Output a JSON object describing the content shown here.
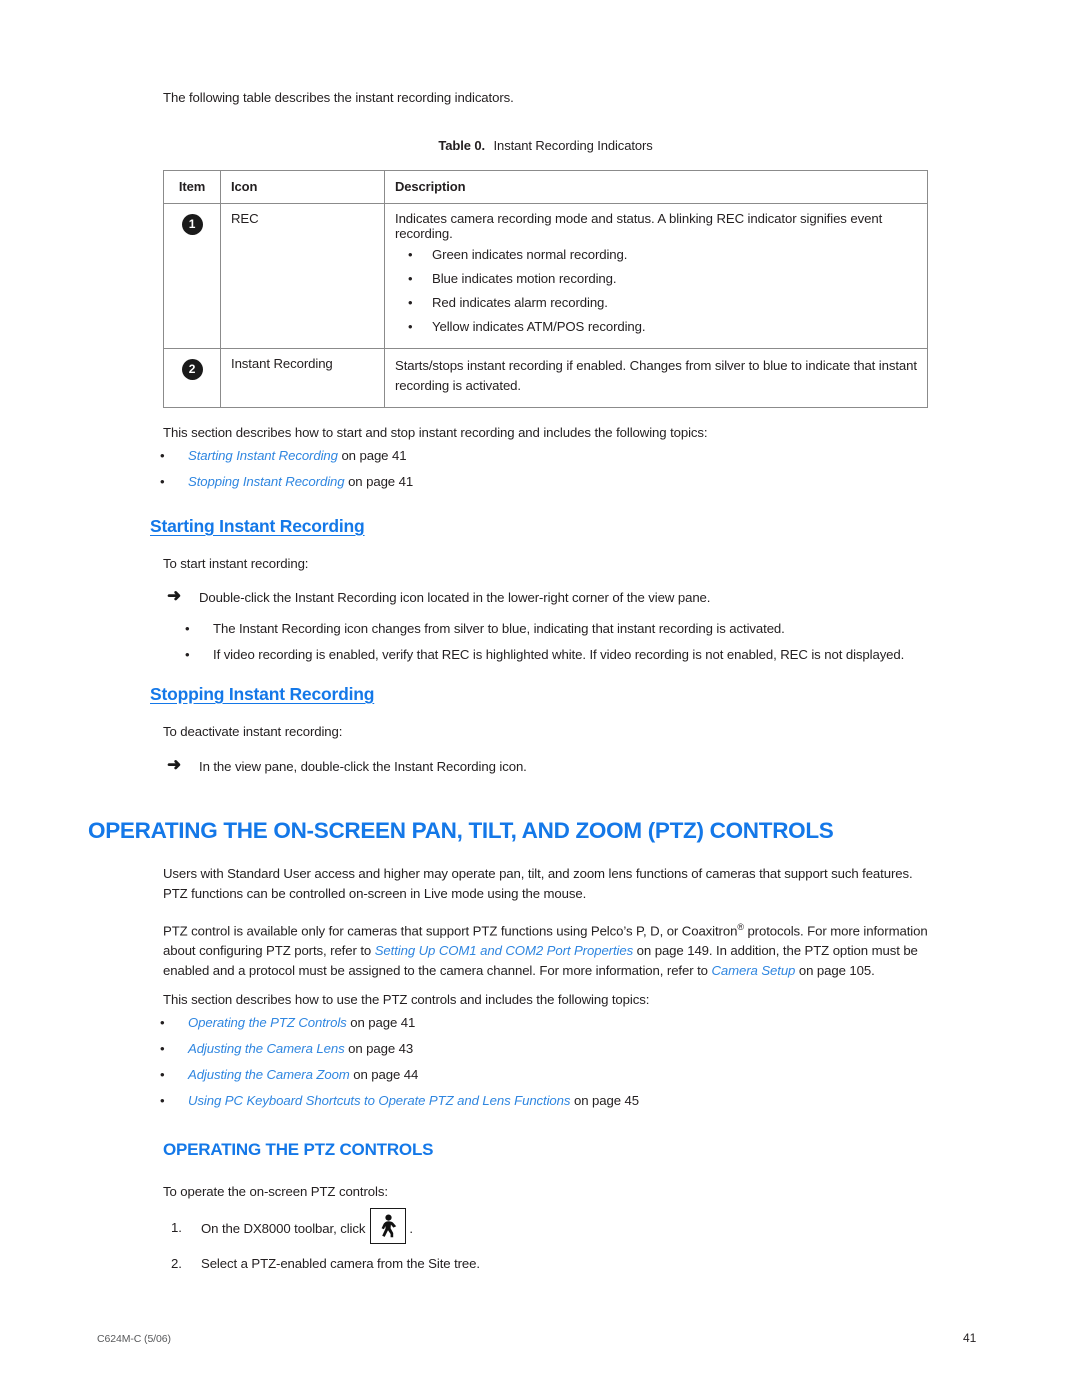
{
  "intro": {
    "lead": "The following table describes the instant recording indicators."
  },
  "table": {
    "caption_label": "Table 0.",
    "caption_text": "Instant Recording Indicators",
    "headers": {
      "item": "Item",
      "icon": "Icon",
      "description": "Description"
    },
    "rows": [
      {
        "item": "1",
        "icon": "REC",
        "description_lead": "Indicates camera recording mode and status. A blinking REC indicator signifies event recording.",
        "description_bullets": [
          "Green indicates normal recording.",
          "Blue indicates motion recording.",
          "Red indicates alarm recording.",
          "Yellow indicates ATM/POS recording."
        ]
      },
      {
        "item": "2",
        "icon": "Instant Recording",
        "description_lead": "Starts/stops instant recording if enabled. Changes from silver to blue to indicate that instant recording is activated.",
        "description_bullets": []
      }
    ]
  },
  "instant_recording": {
    "section_lead": "This section describes how to start and stop instant recording and includes the following topics:",
    "topics": [
      {
        "link": "Starting Instant Recording",
        "suffix": " on page 41"
      },
      {
        "link": "Stopping Instant Recording",
        "suffix": " on page 41"
      }
    ],
    "starting": {
      "heading": "Starting Instant Recording",
      "lead": "To start instant recording:",
      "arrow_step": "Double-click the Instant Recording icon located in the lower-right corner of the view pane.",
      "notes": [
        "The Instant Recording icon changes from silver to blue, indicating that instant recording is activated.",
        "If video recording is enabled, verify that REC is highlighted white. If video recording is not enabled, REC is not displayed."
      ]
    },
    "stopping": {
      "heading": "Stopping Instant Recording",
      "lead": "To deactivate instant recording:",
      "arrow_step": "In the view pane, double-click the Instant Recording icon."
    }
  },
  "ptz": {
    "heading": "OPERATING THE ON-SCREEN PAN, TILT, AND ZOOM (PTZ) CONTROLS",
    "para1": "Users with Standard User access and higher may operate pan, tilt, and zoom lens functions of cameras that support such features. PTZ functions can be controlled on-screen in Live mode using the mouse.",
    "para2_part1": "PTZ control is available only for cameras that support PTZ functions using Pelco’s P, D, or Coaxitron",
    "para2_reg": "®",
    "para2_part2": " protocols. For more information about configuring PTZ ports, refer to ",
    "para2_link1": "Setting Up COM1 and COM2 Port Properties",
    "para2_part3": " on page 149. In addition, the PTZ option must be enabled and a protocol must be assigned to the camera channel. For more information, refer to ",
    "para2_link2": "Camera Setup",
    "para2_part4": " on page 105.",
    "topics_lead": "This section describes how to use the PTZ controls and includes the following topics:",
    "topics": [
      {
        "link": "Operating the PTZ Controls",
        "suffix": " on page 41"
      },
      {
        "link": "Adjusting the Camera Lens",
        "suffix": " on page 43"
      },
      {
        "link": "Adjusting the Camera Zoom",
        "suffix": " on page 44"
      },
      {
        "link": "Using PC Keyboard Shortcuts to Operate PTZ and Lens Functions",
        "suffix": " on page 45"
      }
    ],
    "controls": {
      "heading": "OPERATING THE PTZ CONTROLS",
      "lead": "To operate the on-screen PTZ controls:",
      "step1_num": "1.",
      "step1_before": "On the DX8000 toolbar, click",
      "step1_icon": "ptz-walking-person-icon",
      "step1_after": ".",
      "step2_num": "2.",
      "step2_text": "Select a PTZ-enabled camera from the Site tree."
    }
  },
  "footer": {
    "document_number": "C624M-C (5/06)",
    "page_number": "41"
  },
  "colors": {
    "link_blue": "#2f86e0",
    "heading_blue": "#1478e8",
    "text_black": "#231f20",
    "table_border": "#8b8b8b"
  },
  "glyphs": {
    "bullet": "•",
    "arrow": "➜"
  }
}
